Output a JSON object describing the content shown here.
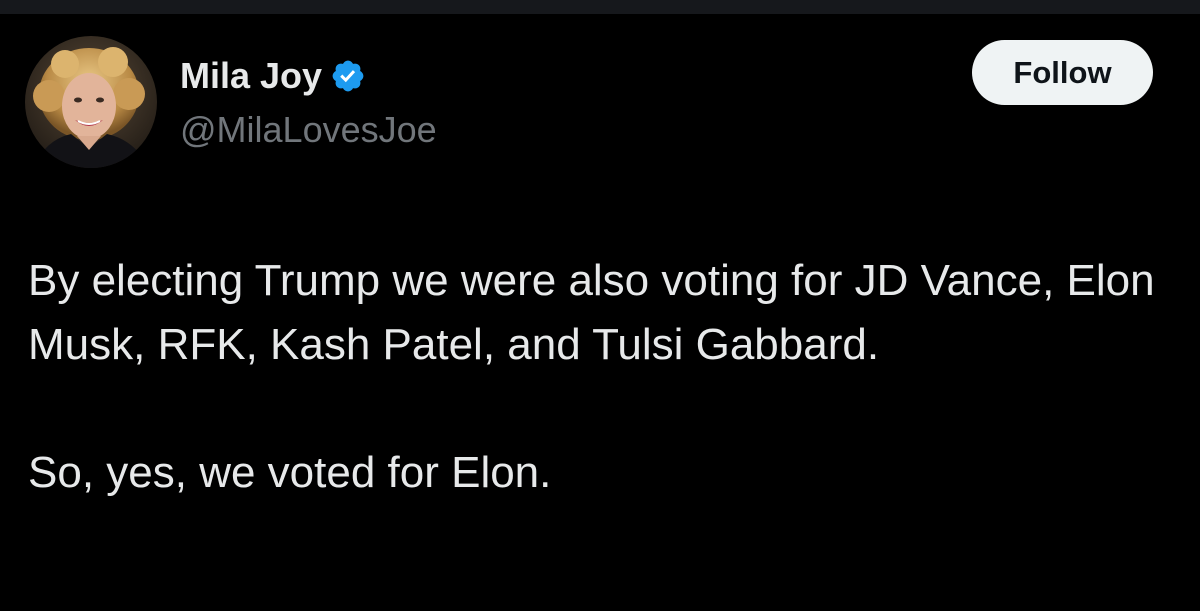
{
  "user": {
    "display_name": "Mila Joy",
    "handle": "@MilaLovesJoe",
    "verified": true,
    "avatar_icon": "profile-photo"
  },
  "actions": {
    "follow_label": "Follow"
  },
  "tweet": {
    "paragraphs": [
      "By electing Trump we were also voting for JD Vance, Elon Musk, RFK, Kash Patel, and Tulsi Gabbard.",
      "So, yes, we voted for Elon."
    ]
  },
  "colors": {
    "background": "#000000",
    "text_primary": "#e7e9ea",
    "text_secondary": "#71767b",
    "verified_blue": "#1d9bf0",
    "follow_bg": "#eff3f4",
    "follow_text": "#0f1419"
  }
}
